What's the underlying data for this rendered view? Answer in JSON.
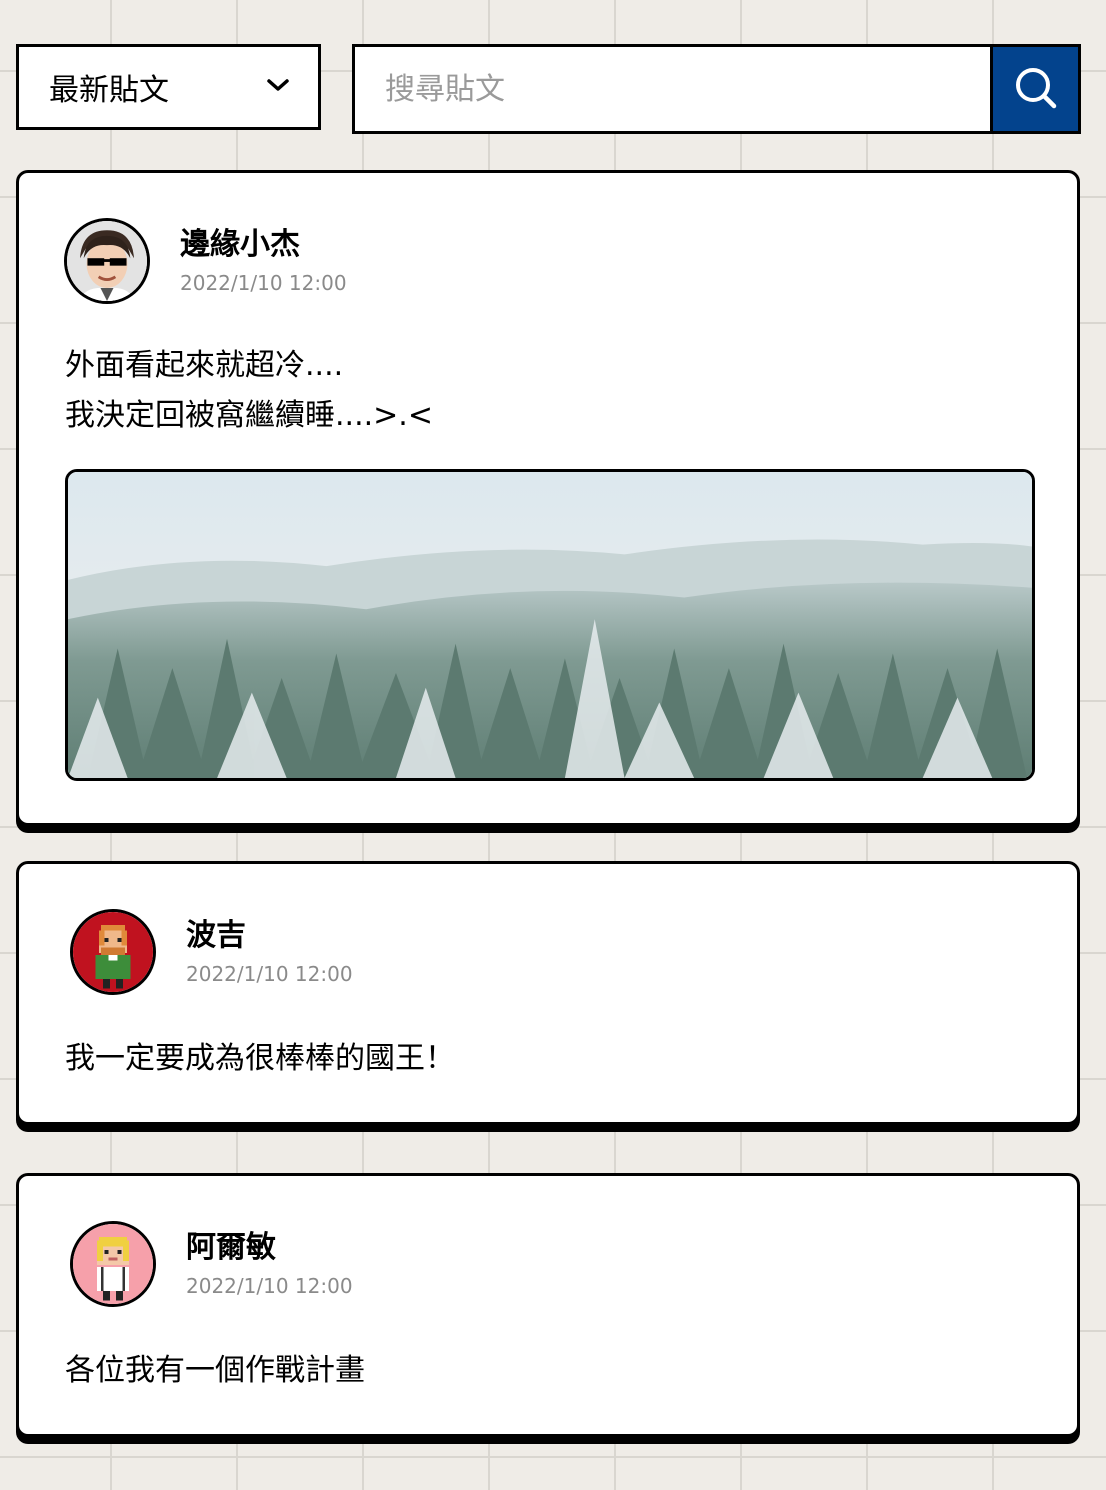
{
  "filter": {
    "selected": "最新貼文",
    "icon": "chevron-down-icon"
  },
  "search": {
    "placeholder": "搜尋貼文",
    "button_icon": "search-icon",
    "button_color": "#03438d"
  },
  "posts": [
    {
      "author": "邊緣小杰",
      "date": "2022/1/10 12:00",
      "content_lines": [
        "外面看起來就超冷....",
        "我決定回被窩繼續睡....>.<"
      ],
      "avatar_icon": "avatar-sunglasses-icon",
      "image": "snowy-forest-image"
    },
    {
      "author": "波吉",
      "date": "2022/1/10 12:00",
      "content_lines": [
        "我一定要成為很棒棒的國王！"
      ],
      "avatar_icon": "avatar-pixel-red-icon",
      "avatar_color": "#c0121f"
    },
    {
      "author": "阿爾敏",
      "date": "2022/1/10 12:00",
      "content_lines": [
        "各位我有一個作戰計畫"
      ],
      "avatar_icon": "avatar-pixel-pink-icon",
      "avatar_color": "#f6a0aa"
    }
  ]
}
